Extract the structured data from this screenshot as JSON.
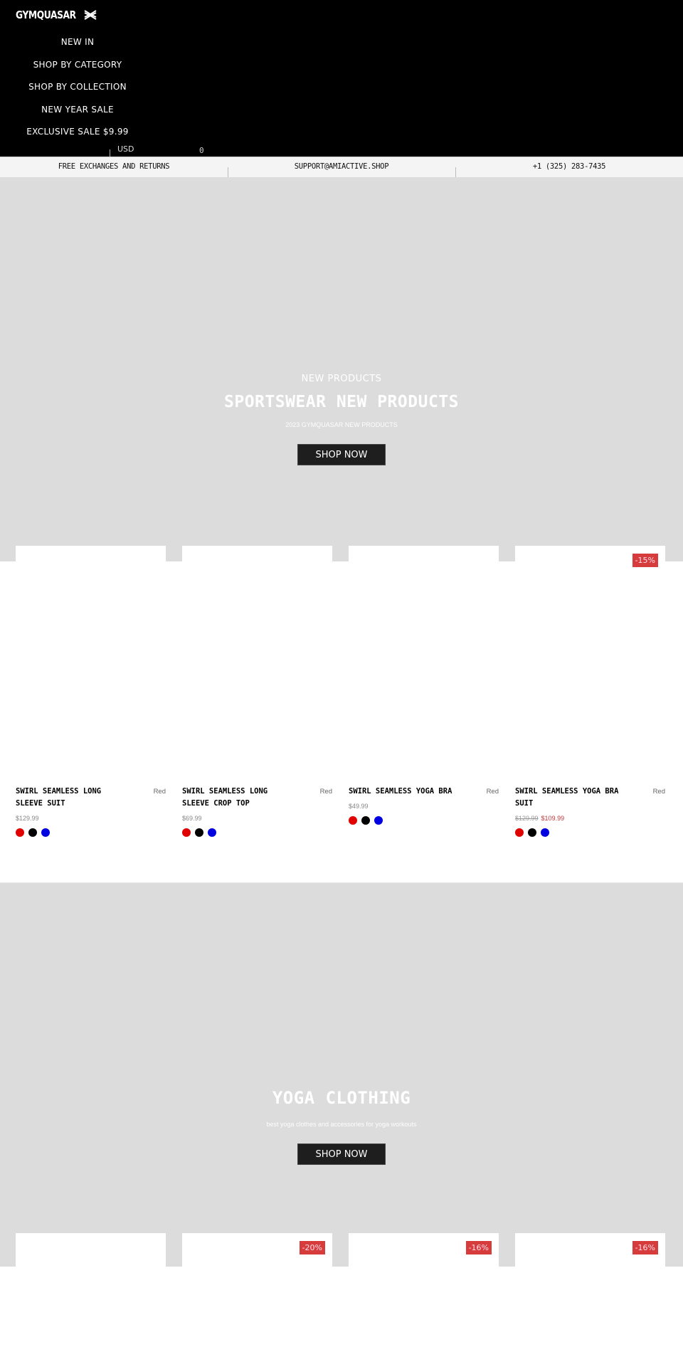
{
  "header": {
    "logo_text": "GYMQUASAR",
    "nav": [
      {
        "label": "NEW IN"
      },
      {
        "label": "SHOP BY CATEGORY"
      },
      {
        "label": "SHOP BY COLLECTION"
      },
      {
        "label": "NEW YEAR SALE"
      },
      {
        "label": "EXCLUSIVE SALE $9.99"
      }
    ],
    "currency": "USD",
    "cart_count": "0"
  },
  "infobar": {
    "items": [
      {
        "text": "FREE EXCHANGES AND RETURNS"
      },
      {
        "text": "SUPPORT@AMIACTIVE.SHOP"
      },
      {
        "text": "+1 (325) 283-7435"
      }
    ]
  },
  "hero1": {
    "eyebrow": "NEW PRODUCTS",
    "title": "SPORTSWEAR NEW PRODUCTS",
    "subtitle": "2023 GYMQUASAR NEW PRODUCTS",
    "button": "SHOP NOW"
  },
  "products1": [
    {
      "title": "SWIRL SEAMLESS LONG SLEEVE SUIT",
      "color": "Red",
      "price": "$129.99",
      "badge": null,
      "swatches": [
        "#e00000",
        "#000000",
        "#0000e0"
      ]
    },
    {
      "title": "SWIRL SEAMLESS LONG SLEEVE CROP TOP",
      "color": "Red",
      "price": "$69.99",
      "badge": null,
      "swatches": [
        "#e00000",
        "#000000",
        "#0000e0"
      ]
    },
    {
      "title": "SWIRL SEAMLESS YOGA BRA",
      "color": "Red",
      "price": "$49.99",
      "badge": null,
      "swatches": [
        "#e00000",
        "#000000",
        "#0000e0"
      ]
    },
    {
      "title": "SWIRL SEAMLESS YOGA BRA SUIT",
      "color": "Red",
      "price_old": "$129.99",
      "price": "$109.99",
      "badge": "-15%",
      "swatches": [
        "#e00000",
        "#000000",
        "#0000e0"
      ]
    }
  ],
  "hero2": {
    "title": "YOGA CLOTHING",
    "subtitle": "best yoga clothes and accessories for yoga workouts",
    "button": "SHOP NOW"
  },
  "products2": [
    {
      "badge": null
    },
    {
      "badge": "-20%"
    },
    {
      "badge": "-16%"
    },
    {
      "badge": "-16%"
    }
  ],
  "colors": {
    "header_bg": "#000000",
    "hero_bg": "#dcdcdc",
    "button_bg": "#1e1e1e",
    "badge_bg": "#d63c3c",
    "sale_price": "#c0393b"
  }
}
